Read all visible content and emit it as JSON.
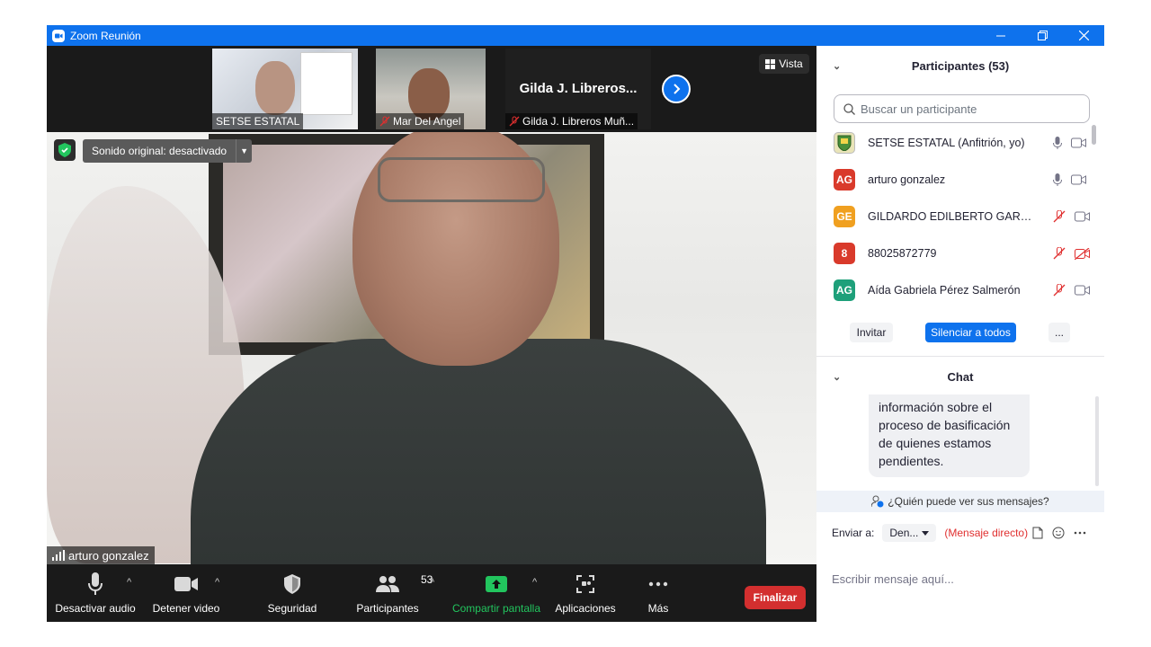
{
  "window": {
    "title": "Zoom Reunión",
    "controls": [
      "minimize",
      "restore",
      "close"
    ]
  },
  "gallery": {
    "thumbnails": [
      {
        "name": "SETSE ESTATAL",
        "muted": false
      },
      {
        "name": "Mar Del Angel",
        "muted": true
      },
      {
        "name": "Gilda J. Libreros Muñ...",
        "display": "Gilda J. Libreros...",
        "muted": true
      }
    ],
    "vista_label": "Vista"
  },
  "main_video": {
    "sound_label": "Sonido original: desactivado",
    "speaker_name": "arturo gonzalez"
  },
  "toolbar": {
    "audio_label": "Desactivar audio",
    "video_label": "Detener video",
    "security_label": "Seguridad",
    "participants_label": "Participantes",
    "participants_count": "53",
    "share_label": "Compartir pantalla",
    "apps_label": "Aplicaciones",
    "more_label": "Más",
    "end_label": "Finalizar"
  },
  "participants_panel": {
    "title": "Participantes (53)",
    "search_placeholder": "Buscar un participante",
    "list": [
      {
        "initials": "",
        "name": "SETSE ESTATAL (Anfitrión, yo)",
        "color": "#e9e4b8",
        "mic": "on",
        "video": "on"
      },
      {
        "initials": "AG",
        "name": "arturo gonzalez",
        "color": "#d93a2b",
        "mic": "on",
        "video": "on"
      },
      {
        "initials": "GE",
        "name": "GILDARDO EDILBERTO GARCIA ...",
        "color": "#f0a020",
        "mic": "muted",
        "video": "on"
      },
      {
        "initials": "8",
        "name": "88025872779",
        "color": "#d93a2b",
        "mic": "muted",
        "video": "off"
      },
      {
        "initials": "AG",
        "name": "Aída Gabriela Pérez Salmerón",
        "color": "#1ea07a",
        "mic": "muted",
        "video": "on"
      }
    ],
    "invite_label": "Invitar",
    "mute_all_label": "Silenciar a todos",
    "more_label": "..."
  },
  "chat_panel": {
    "title": "Chat",
    "messages": [
      "información sobre el proceso de basificación de quienes estamos pendientes."
    ],
    "who_can_see": "¿Quién puede ver sus mensajes?",
    "send_to_label": "Enviar a:",
    "recipient": "Den...",
    "direct_label": "(Mensaje directo)",
    "input_placeholder": "Escribir mensaje aquí..."
  },
  "colors": {
    "brand_blue": "#0e72ed",
    "end_red": "#d32f2f",
    "share_green": "#22c55e",
    "muted_red": "#e02f2f"
  }
}
